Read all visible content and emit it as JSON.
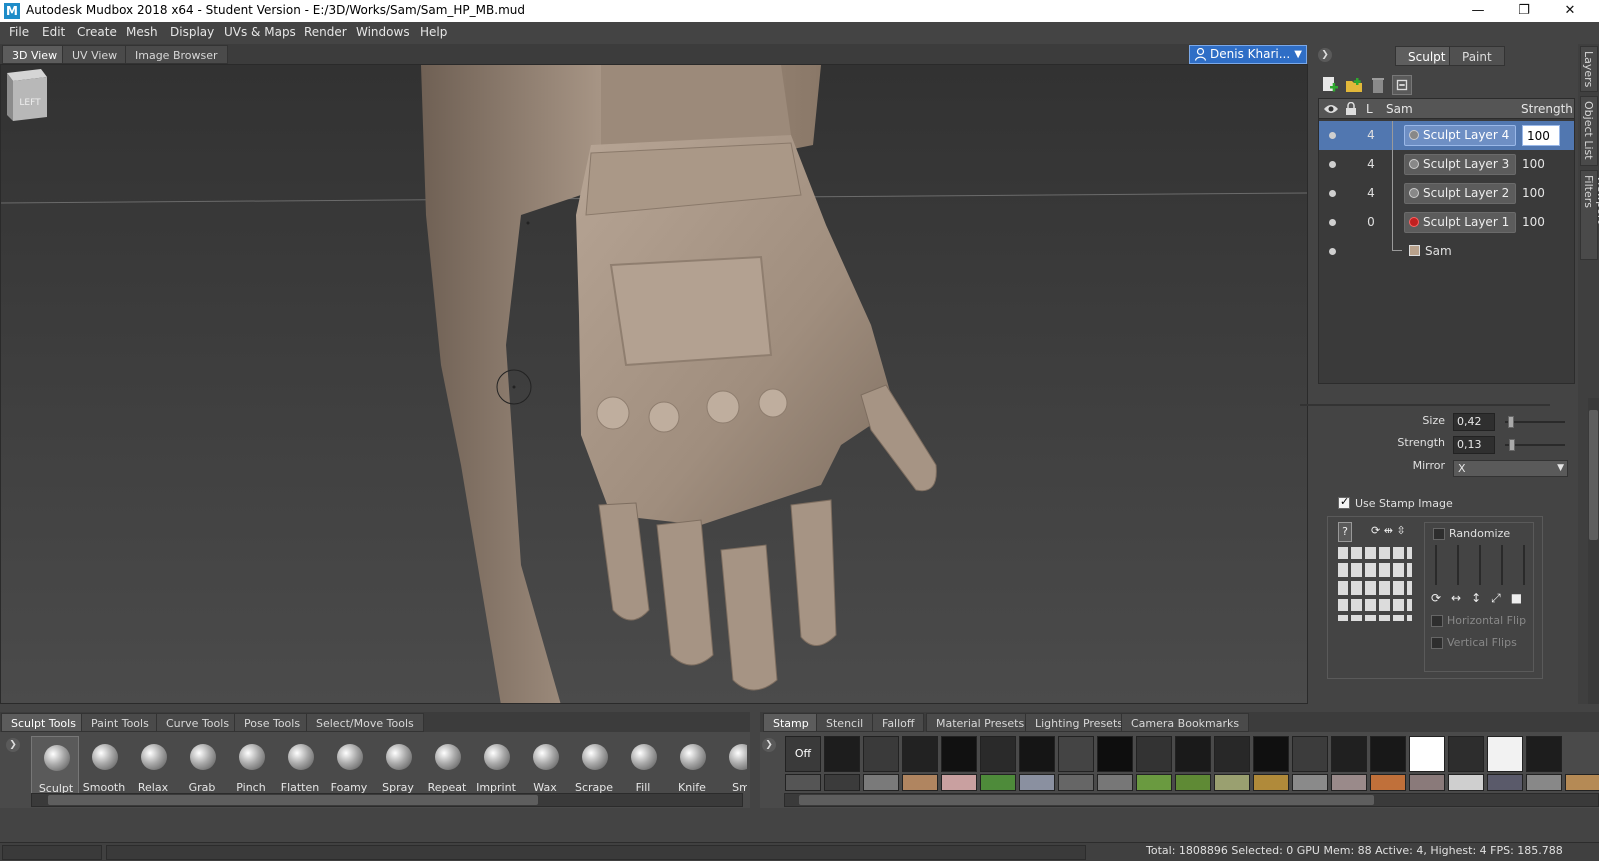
{
  "window": {
    "title": "Autodesk Mudbox 2018 x64 - Student Version - E:/3D/Works/Sam/Sam_HP_MB.mud",
    "logo_letter": "M",
    "minimize": "—",
    "maximize": "❐",
    "close": "✕"
  },
  "menu": [
    "File",
    "Edit",
    "Create",
    "Mesh",
    "Display",
    "UVs & Maps",
    "Render",
    "Windows",
    "Help"
  ],
  "view_tabs": [
    "3D View",
    "UV View",
    "Image Browser"
  ],
  "active_view_tab": 0,
  "user": {
    "name": "Denis Khari..."
  },
  "viewcube": {
    "label": "LEFT"
  },
  "right_panel": {
    "mode_tabs": [
      "Sculpt",
      "Paint"
    ],
    "active_mode": 0,
    "layers": {
      "header": {
        "level": "L",
        "object": "Sam",
        "strength": "Strength"
      },
      "rows": [
        {
          "level": "4",
          "name": "Sculpt Layer 4",
          "strength": "100",
          "selected": true
        },
        {
          "level": "4",
          "name": "Sculpt Layer 3",
          "strength": "100",
          "selected": false
        },
        {
          "level": "4",
          "name": "Sculpt Layer 2",
          "strength": "100",
          "selected": false
        },
        {
          "level": "0",
          "name": "Sculpt Layer 1",
          "strength": "100",
          "selected": false,
          "icon": "red"
        }
      ],
      "object_name": "Sam"
    },
    "properties": {
      "size_label": "Size",
      "size_value": "0,42",
      "strength_label": "Strength",
      "strength_value": "0,13",
      "mirror_label": "Mirror",
      "mirror_value": "X"
    },
    "stamp": {
      "use_stamp_label": "Use Stamp Image",
      "use_stamp_checked": true,
      "help_glyph": "?",
      "randomize_label": "Randomize",
      "horizontal_flip_label": "Horizontal Flip",
      "vertical_flips_label": "Vertical Flips"
    }
  },
  "side_tabs": [
    "Layers",
    "Object List",
    "Viewport Filters"
  ],
  "shelf": {
    "tabs": [
      "Sculpt Tools",
      "Paint Tools",
      "Curve Tools",
      "Pose Tools",
      "Select/Move Tools"
    ],
    "active_tab": 0,
    "tools": [
      "Sculpt",
      "Smooth",
      "Relax",
      "Grab",
      "Pinch",
      "Flatten",
      "Foamy",
      "Spray",
      "Repeat",
      "Imprint",
      "Wax",
      "Scrape",
      "Fill",
      "Knife",
      "Sm"
    ],
    "active_tool": 0
  },
  "tray": {
    "tabs": [
      "Stamp",
      "Stencil",
      "Falloff",
      "Material Presets",
      "Lighting Presets",
      "Camera Bookmarks"
    ],
    "active_tab": 0,
    "off_label": "Off"
  },
  "status": {
    "text": "Total: 1808896  Selected: 0 GPU Mem: 88  Active: 4, Highest: 4  FPS: 185.788"
  },
  "colors": {
    "accent": "#2f6ec6",
    "selection": "#5177b0",
    "model": "#a08f80"
  }
}
